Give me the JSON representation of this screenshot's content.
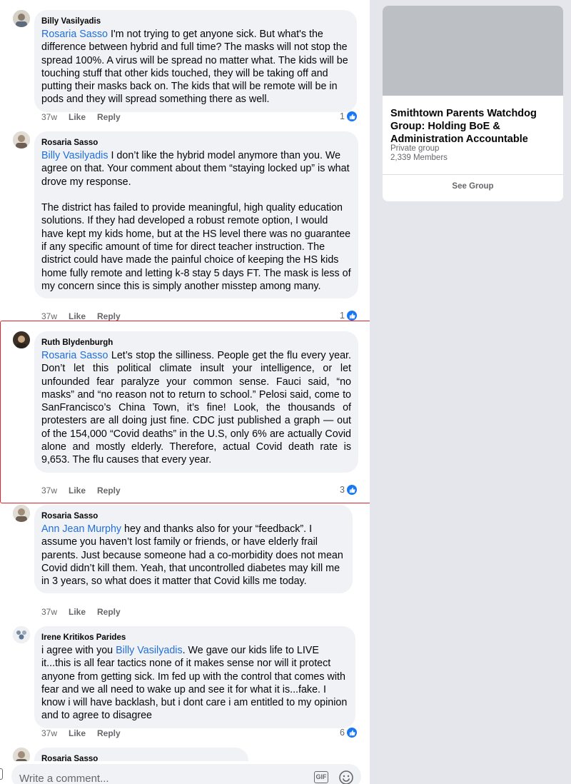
{
  "comments": [
    {
      "author": "Billy Vasilyadis",
      "mention": "Rosaria Sasso",
      "paragraphs": [
        "I'm not trying to get anyone sick. But what's the difference between hybrid and full time? The masks will not stop the spread 100%. A virus will be spread no matter what. The kids will be touching stuff that other kids touched, they will be taking off and putting their masks back on. The kids that will be remote will be in pods and they will spread something there as well."
      ],
      "time": "37w",
      "like_label": "Like",
      "reply_label": "Reply",
      "reactions": "1"
    },
    {
      "author": "Rosaria Sasso",
      "mention": "Billy Vasilyadis",
      "paragraphs": [
        "I don’t like the hybrid model anymore than you. We agree on that. Your comment about them “staying locked up” is what drove my response.",
        "The district has failed to provide meaningful, high quality education solutions. If they had developed a robust remote option, I would have kept my kids home, but at the HS level there was no guarantee if any specific amount of time for direct teacher instruction. The district could have made the painful choice of keeping the HS kids home fully remote and letting k-8 stay 5 days FT. The mask is less of my concern since this is simply another misstep among many."
      ],
      "time": "37w",
      "like_label": "Like",
      "reply_label": "Reply",
      "reactions": "1"
    },
    {
      "author": "Ruth Blydenburgh",
      "mention": "Rosaria Sasso",
      "paragraphs": [
        "Let’s stop the silliness. People get the flu every year. Don’t let this political climate insult your intelligence, or let unfounded fear paralyze your common sense. Fauci said, “no masks” and “no reason not to return to school.” Pelosi said, come to SanFrancisco’s China Town, it’s fine! Look, the thousands of protesters are all doing just fine. CDC just published a graph — out of the 154,000 “Covid deaths” in the U.S, only 6% are actually Covid alone and mostly elderly. Therefore, actual Covid death rate is 9,653. The flu causes that every year."
      ],
      "time": "37w",
      "like_label": "Like",
      "reply_label": "Reply",
      "reactions": "3"
    },
    {
      "author": "Rosaria Sasso",
      "mention": "Ann Jean Murphy",
      "paragraphs": [
        "hey and thanks also for your “feedback”. I assume you haven’t lost family or friends, or have elderly frail parents. Just because someone had a co-morbidity does not mean Covid didn’t kill them. Yeah, that uncontrolled diabetes may kill me in 3 years, so what does it matter that Covid kills me today."
      ],
      "time": "37w",
      "like_label": "Like",
      "reply_label": "Reply",
      "reactions": ""
    },
    {
      "author": "Irene Kritikos Parides",
      "prefix": "i agree with you ",
      "mention": "Billy Vasilyadis",
      "paragraphs": [
        ".  We gave our kids life to LIVE it...this is all fear tactics none of it makes sense nor will it protect anyone from getting sick.  Im fed up with the control that comes with fear and we all need to wake up and see it for what it is...fake.  I know i will have backlash, but i dont care i am entitled to my opinion and to agree to disagree"
      ],
      "time": "37w",
      "like_label": "Like",
      "reply_label": "Reply",
      "reactions": "6"
    },
    {
      "author": "Rosaria Sasso"
    }
  ],
  "composer": {
    "placeholder": "Write a comment...",
    "gif_label": "GIF"
  },
  "group_card": {
    "name": "Smithtown Parents Watchdog Group: Holding BoE & Administration Accountable",
    "privacy": "Private group",
    "members": "2,339 Members",
    "button_label": "See Group"
  },
  "colors": {
    "mention": "#216fdb",
    "bubble": "#f0f2f5",
    "highlight": "#e0242b",
    "like_badge": "#1877f2"
  }
}
